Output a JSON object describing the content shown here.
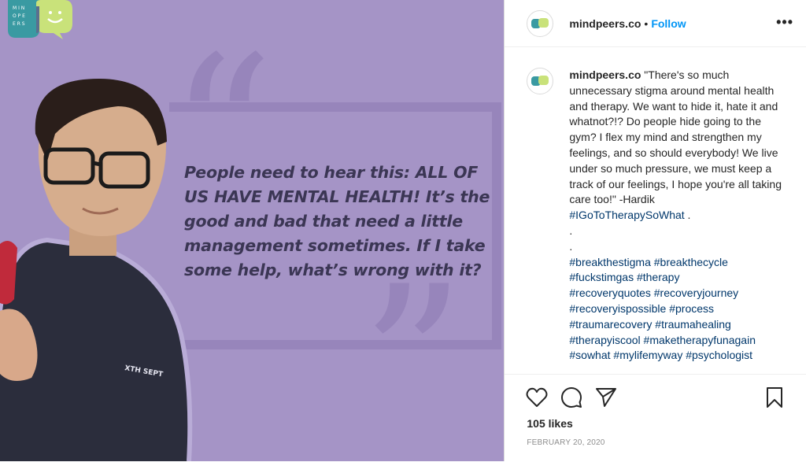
{
  "post": {
    "quote": "People need to hear this: ALL OF US HAVE MENTAL HEALTH! It’s the good and bad that need a little management sometimes. If I take some help, what’s wrong with it?",
    "logo_letters": "M I N D P E E R S",
    "shirt_text": "XTH SEPT"
  },
  "header": {
    "username": "mindpeers.co",
    "dot": "•",
    "follow_label": "Follow",
    "more_label": "•••"
  },
  "caption": {
    "username": "mindpeers.co",
    "text": "\"There's so much unnecessary stigma around mental health and therapy. We want to hide it, hate it and whatnot?!? Do people hide going to the gym? I flex my mind and strengthen my feelings, and so should everybody! We live under so much pressure, we must keep a track of our feelings, I hope you're all taking care too!\" -Hardik",
    "hashtag_line": "#IGoToTherapySoWhat",
    "after_hashtag": " .",
    "dots": [
      ".",
      "."
    ],
    "hashtags": [
      "#breakthestigma #breakthecycle",
      "#fuckstimgas #therapy",
      "#recoveryquotes #recoveryjourney",
      "#recoveryispossible #process",
      "#traumarecovery #traumahealing",
      "#therapyiscool #maketherapyfunagain",
      "#sowhat #mylifemyway #psychologist"
    ]
  },
  "footer": {
    "likes": "105 likes",
    "date": "FEBRUARY 20, 2020"
  },
  "colors": {
    "background_purple": "#a594c6",
    "follow_blue": "#0095f6",
    "hashtag": "#00376b"
  }
}
